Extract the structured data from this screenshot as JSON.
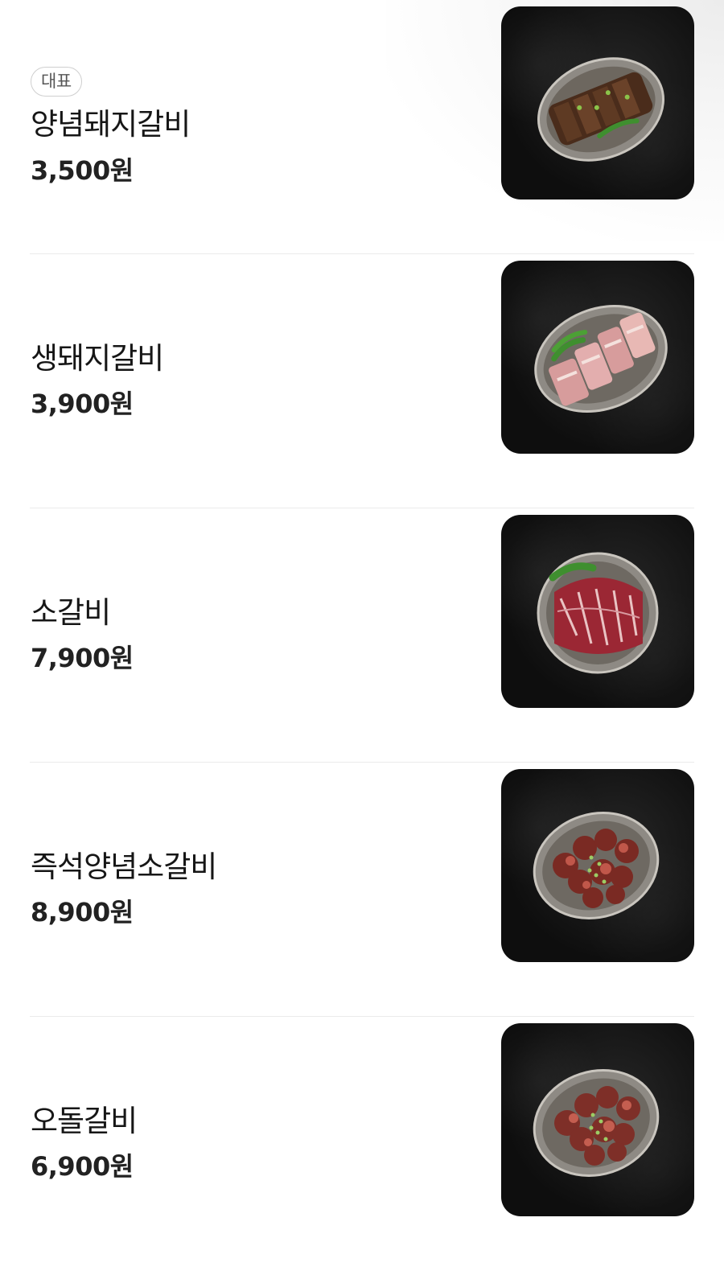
{
  "menu": {
    "items": [
      {
        "badge": "대표",
        "name": "양념돼지갈비",
        "price": "3,500원",
        "photo": "marinated-pork-ribs"
      },
      {
        "name": "생돼지갈비",
        "price": "3,900원",
        "photo": "fresh-pork-ribs"
      },
      {
        "name": "소갈비",
        "price": "7,900원",
        "photo": "beef-ribs"
      },
      {
        "name": "즉석양념소갈비",
        "price": "8,900원",
        "photo": "instant-marinated-beef-ribs"
      },
      {
        "name": "오돌갈비",
        "price": "6,900원",
        "photo": "odol-ribs"
      }
    ]
  },
  "colors": {
    "background": "#ffffff",
    "text": "#1a1a1a",
    "divider": "#ebebeb",
    "badge_border": "#cfcfcf",
    "photo_bg": "#111111"
  }
}
